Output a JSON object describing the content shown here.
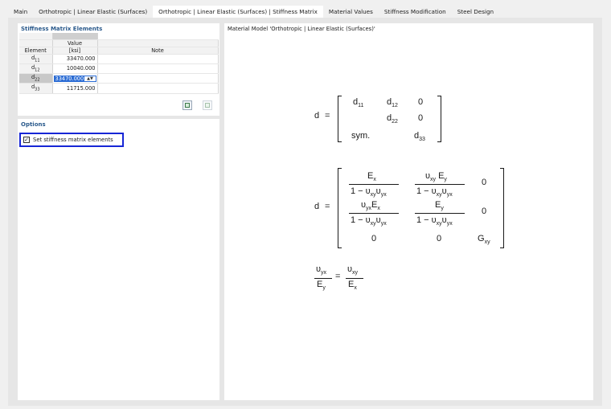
{
  "tabs": [
    {
      "label": "Main",
      "active": false
    },
    {
      "label": "Orthotropic | Linear Elastic (Surfaces)",
      "active": false
    },
    {
      "label": "Orthotropic | Linear Elastic (Surfaces) | Stiffness Matrix",
      "active": true
    },
    {
      "label": "Material Values",
      "active": false
    },
    {
      "label": "Stiffness Modification",
      "active": false
    },
    {
      "label": "Steel Design",
      "active": false
    }
  ],
  "stiffness": {
    "title": "Stiffness Matrix Elements",
    "col_element": "Element",
    "col_value_top": "Value",
    "col_value_unit": "[ksi]",
    "col_note": "Note",
    "rows": [
      {
        "element": "d11",
        "value": "33470.000",
        "note": ""
      },
      {
        "element": "d12",
        "value": "10040.000",
        "note": ""
      },
      {
        "element": "d22",
        "value": "33470.000",
        "note": ""
      },
      {
        "element": "d33",
        "value": "11715.000",
        "note": ""
      }
    ]
  },
  "options": {
    "title": "Options",
    "set_stiffness_label": "Set stiffness matrix elements",
    "set_stiffness_checked": true
  },
  "model": {
    "title": "Material Model 'Orthotropic | Linear Elastic (Surfaces)'"
  },
  "formula": {
    "d": "d",
    "eq": "=",
    "d11": "d",
    "s11": "11",
    "d12": "d",
    "s12": "12",
    "d22": "d",
    "s22": "22",
    "d33": "d",
    "s33": "33",
    "zero": "0",
    "sym": "sym.",
    "ex": "E",
    "ex_sub": "x",
    "ey": "E",
    "ey_sub": "y",
    "gxy": "G",
    "gxy_sub": "xy",
    "denom": "1 − υ",
    "xy": "xy",
    "yx": "yx",
    "upsilon": "υ"
  },
  "colors": {
    "accent_title": "#2b5a8c",
    "highlight_border": "#1726d6",
    "selection": "#2b6cd4"
  }
}
